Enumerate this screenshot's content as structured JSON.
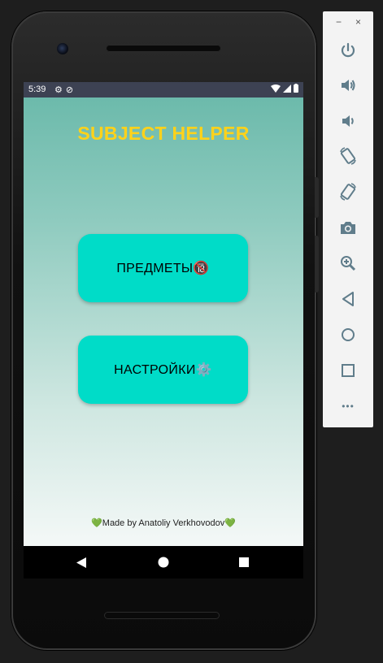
{
  "status_bar": {
    "time": "5:39"
  },
  "app": {
    "title": "SUBJECT HELPER",
    "buttons": [
      {
        "label": "ПРЕДМЕТЫ🔞"
      },
      {
        "label": "НАСТРОЙКИ⚙️"
      }
    ],
    "footer": "💚Made by Anatoliy Verkhovodov💚"
  },
  "emulator_toolbar": {
    "minimize": "−",
    "close": "×",
    "more": "•••"
  },
  "colors": {
    "title": "#ffd21a",
    "button": "#00dcc8",
    "status_bar": "#3d4253",
    "toolbar_icon": "#607d8b"
  },
  "icons": [
    "power-icon",
    "volume-up-icon",
    "volume-down-icon",
    "rotate-left-icon",
    "rotate-right-icon",
    "camera-icon",
    "zoom-icon",
    "back-icon",
    "home-icon",
    "overview-icon",
    "more-icon"
  ]
}
